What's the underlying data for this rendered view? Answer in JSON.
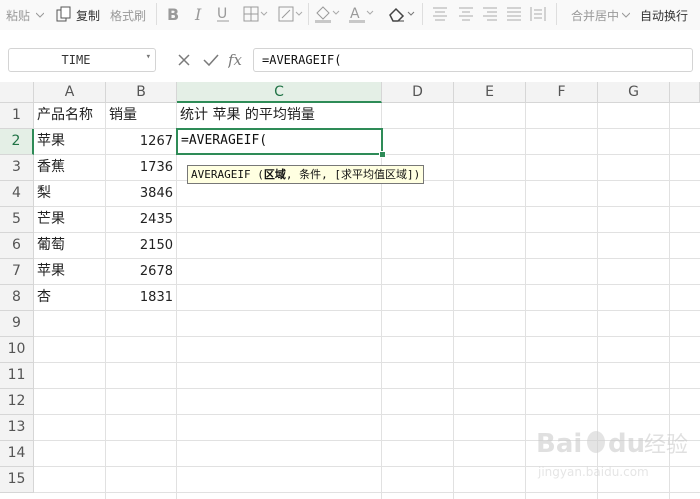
{
  "toolbar": {
    "paste_label": "粘贴",
    "copy_label": "复制",
    "format_painter_label": "格式刷",
    "merge_label": "合并居中",
    "wrap_label": "自动换行",
    "icons": [
      "paste-icon",
      "copy-icon",
      "bold-icon",
      "italic-icon",
      "underline-icon",
      "border-icon",
      "fill-color-icon",
      "font-color-icon",
      "clear-icon",
      "align-top-icon",
      "align-middle-icon",
      "align-bottom-icon",
      "justify-icon",
      "distributed-icon"
    ]
  },
  "formula_bar": {
    "name_box": "TIME",
    "formula": "=AVERAGEIF("
  },
  "columns": [
    "A",
    "B",
    "C",
    "D",
    "E",
    "F",
    "G"
  ],
  "rows": [
    "1",
    "2",
    "3",
    "4",
    "5",
    "6",
    "7",
    "8",
    "9",
    "10",
    "11",
    "12",
    "13",
    "14",
    "15"
  ],
  "cells": {
    "A1": "产品名称",
    "B1": "销量",
    "C1": "统计 苹果 的平均销量",
    "A2": "苹果",
    "B2": "1267",
    "A3": "香蕉",
    "B3": "1736",
    "A4": "梨",
    "B4": "3846",
    "A5": "芒果",
    "B5": "2435",
    "A6": "葡萄",
    "B6": "2150",
    "A7": "苹果",
    "B7": "2678",
    "A8": "杏",
    "B8": "1831",
    "C2": "=AVERAGEIF("
  },
  "tooltip": {
    "func": "AVERAGEIF",
    "open": " (",
    "arg1": "区域",
    "rest": ", 条件, [求平均值区域])"
  },
  "active_cell": "C2",
  "colors": {
    "accent": "#2e8b57",
    "tooltip_bg": "#ffffe1"
  },
  "watermark": {
    "brand": "Baidu",
    "text": "经验",
    "url": "jingyan.baidu.com"
  }
}
